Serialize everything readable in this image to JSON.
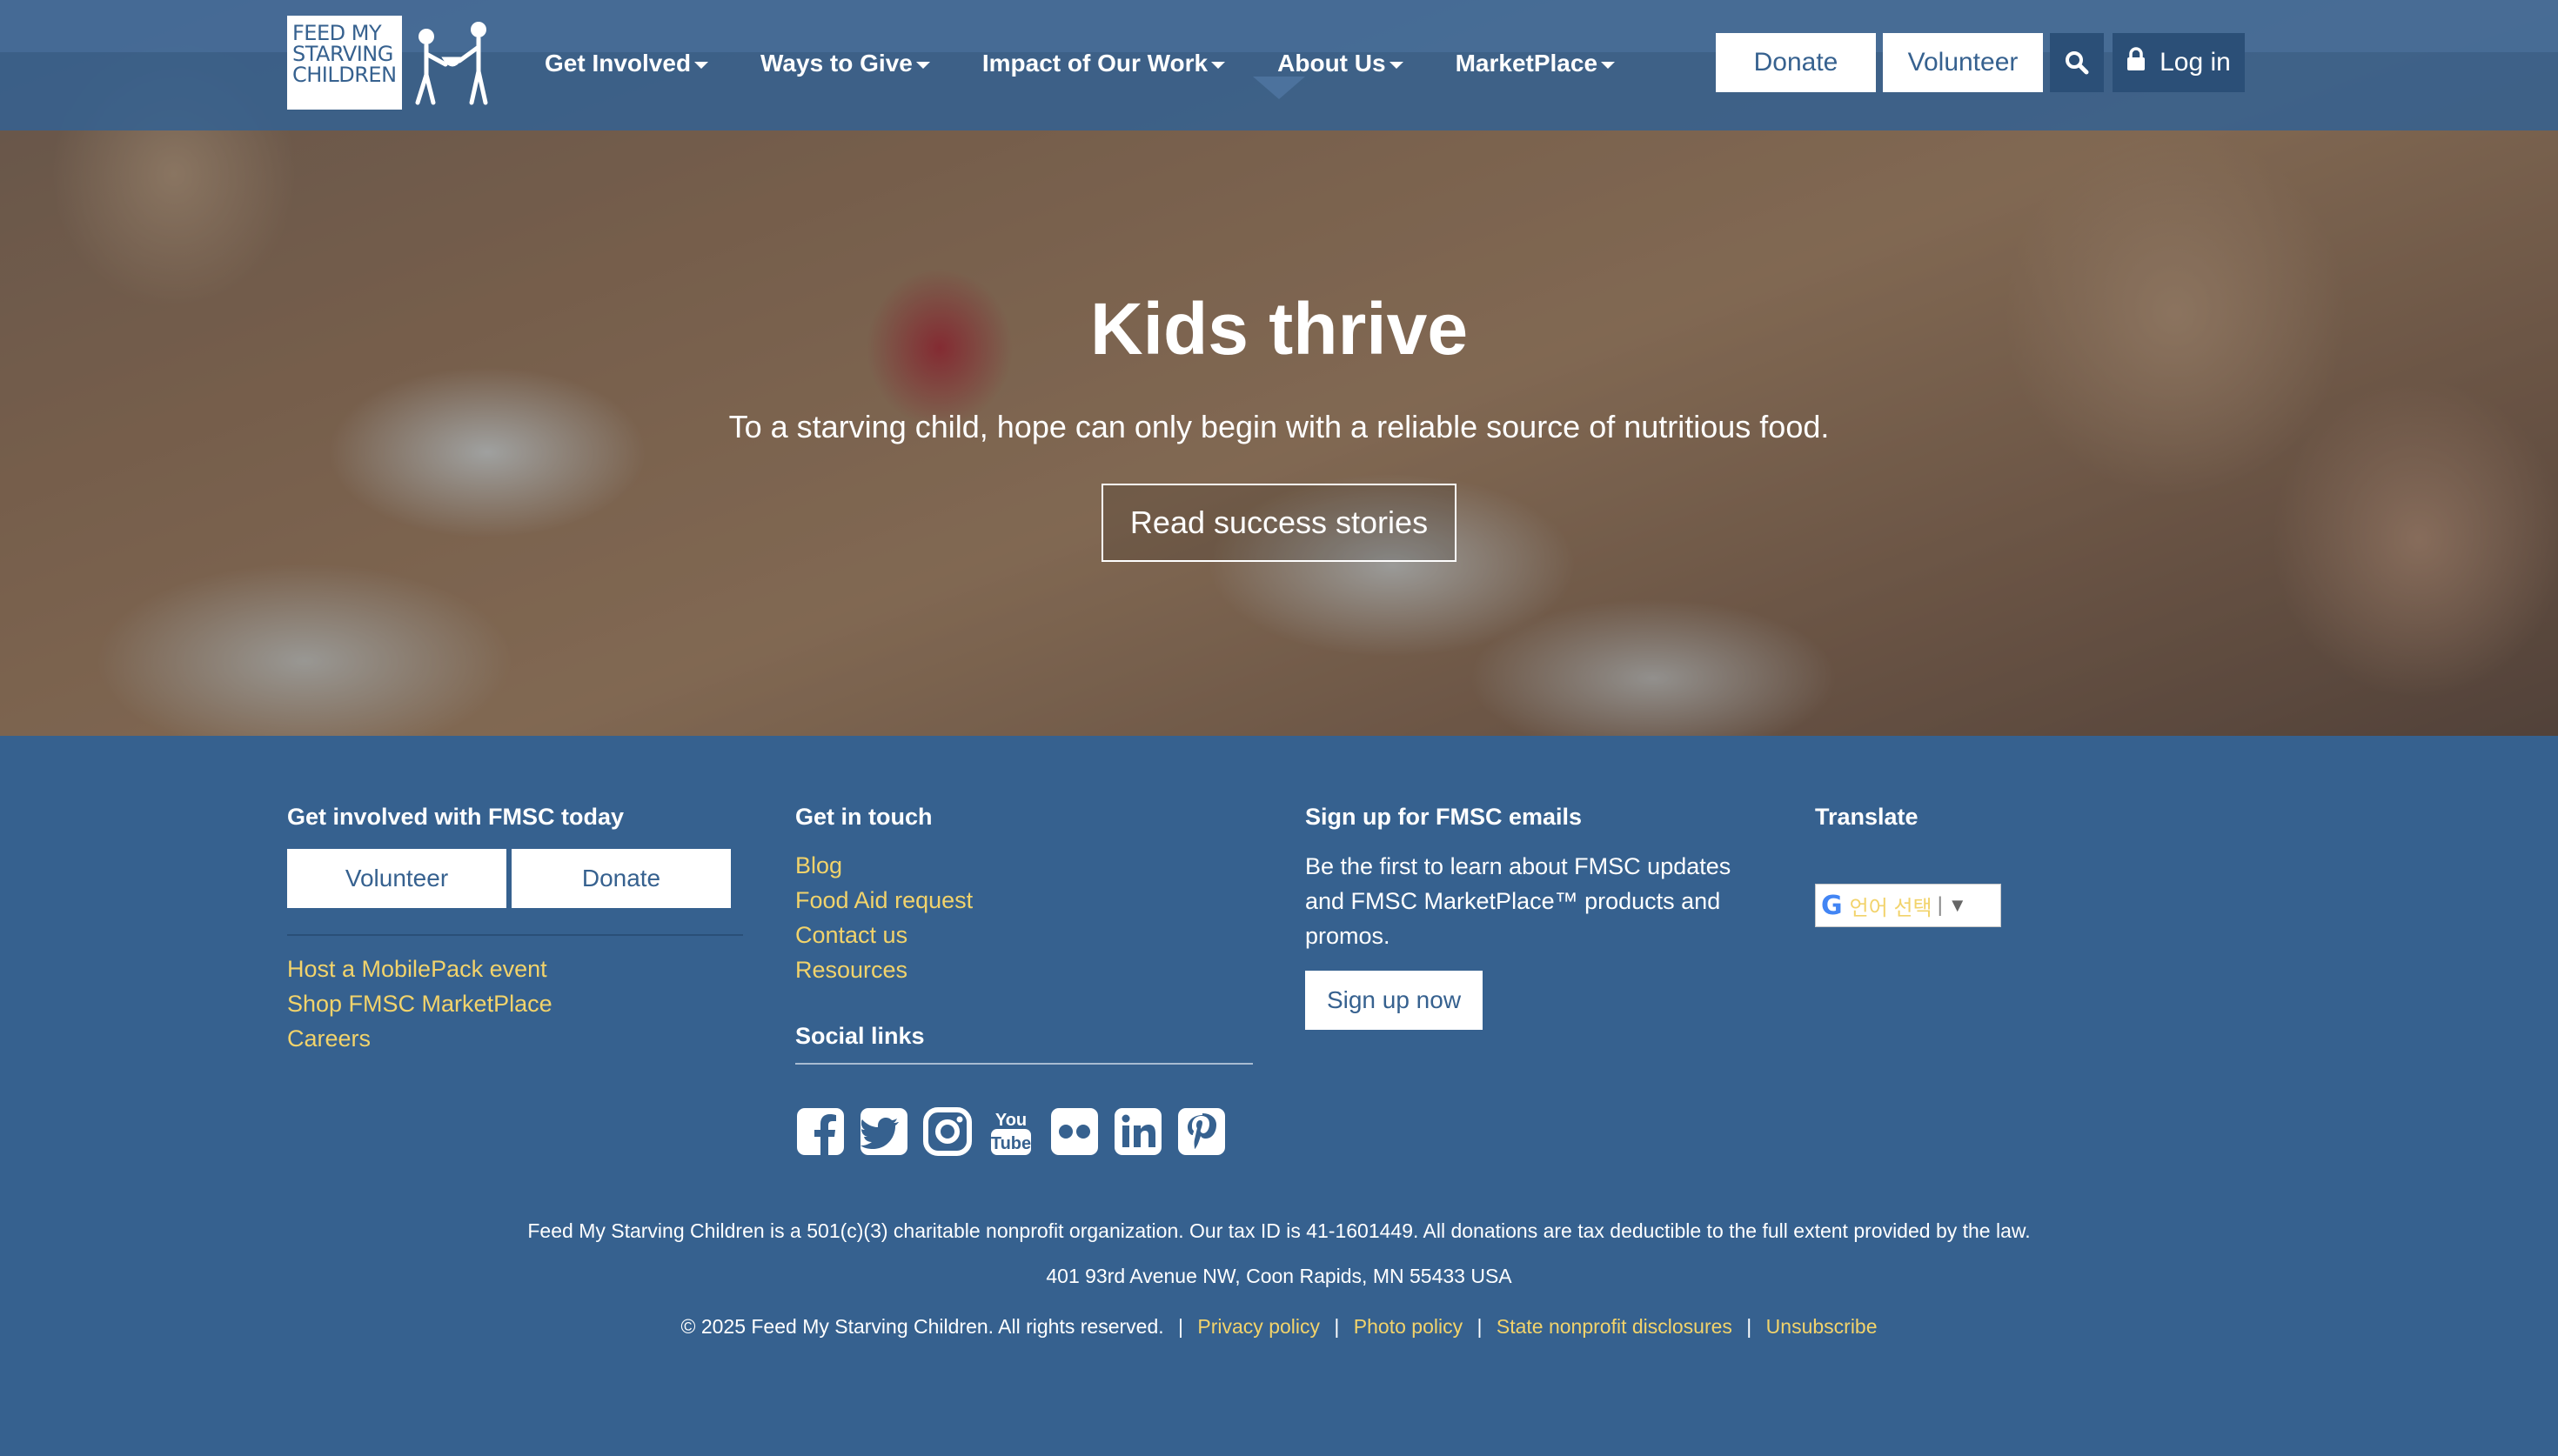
{
  "header": {
    "logo_text": [
      "FEED MY",
      "STARVING",
      "CHILDREN"
    ],
    "nav": [
      {
        "label": "Get Involved"
      },
      {
        "label": "Ways to Give"
      },
      {
        "label": "Impact of Our Work"
      },
      {
        "label": "About Us"
      },
      {
        "label": "MarketPlace"
      }
    ],
    "donate_label": "Donate",
    "volunteer_label": "Volunteer",
    "login_label": "Log in"
  },
  "hero": {
    "title": "Kids thrive",
    "subtitle": "To a starving child, hope can only begin with a reliable source of nutritious food.",
    "button": "Read success stories"
  },
  "footer": {
    "col1": {
      "heading": "Get involved with FMSC today",
      "volunteer_label": "Volunteer",
      "donate_label": "Donate",
      "links": [
        "Host a MobilePack event",
        "Shop FMSC MarketPlace",
        "Careers"
      ]
    },
    "col2": {
      "heading": "Get in touch",
      "links": [
        "Blog",
        "Food Aid request",
        "Contact us",
        "Resources"
      ],
      "social_heading": "Social links",
      "social_icons": [
        "facebook-icon",
        "twitter-icon",
        "instagram-icon",
        "youtube-icon",
        "flickr-icon",
        "linkedin-icon",
        "pinterest-icon"
      ]
    },
    "col3": {
      "heading": "Sign up for FMSC emails",
      "text_lines": [
        "Be the first to learn about FMSC updates",
        "and FMSC MarketPlace™ products and",
        "promos."
      ],
      "button": "Sign up now"
    },
    "col4": {
      "heading": "Translate",
      "select_value": "언어 선택",
      "select_arrow": "▼"
    },
    "legal": {
      "nonprofit": "Feed My Starving Children is a 501(c)(3) charitable nonprofit organization. Our tax ID is 41-1601449. All donations are tax deductible to the full extent provided by the law.",
      "address": "401 93rd Avenue NW, Coon Rapids, MN 55433 USA",
      "copyright": "© 2025  Feed My Starving Children. All rights reserved.",
      "links": [
        "Privacy policy",
        "Photo policy",
        "State nonprofit disclosures",
        "Unsubscribe"
      ]
    }
  },
  "colors": {
    "brand_blue": "#36618f",
    "link_yellow": "#f2d36b",
    "dark_button": "#2b4f77"
  }
}
